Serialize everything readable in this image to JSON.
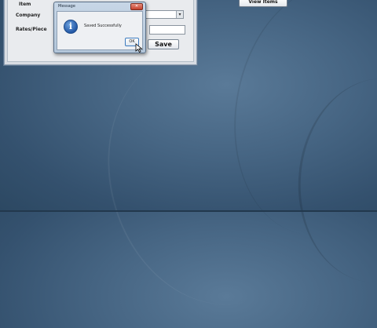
{
  "form": {
    "item_label": "Item",
    "company_label": "Company",
    "rates_label": "Rates/Piece",
    "company_value": "",
    "rate_value": "",
    "save_label": "Save"
  },
  "top_buttons": {
    "view_items_label": "View Items"
  },
  "dialog": {
    "title": "Message",
    "message": "Saved Successfully",
    "ok_label": "OK",
    "icon": "info-icon"
  },
  "colors": {
    "desktop": "#466583",
    "dialog_title_bg": "#c7d6e6",
    "close_button": "#c4412c"
  }
}
